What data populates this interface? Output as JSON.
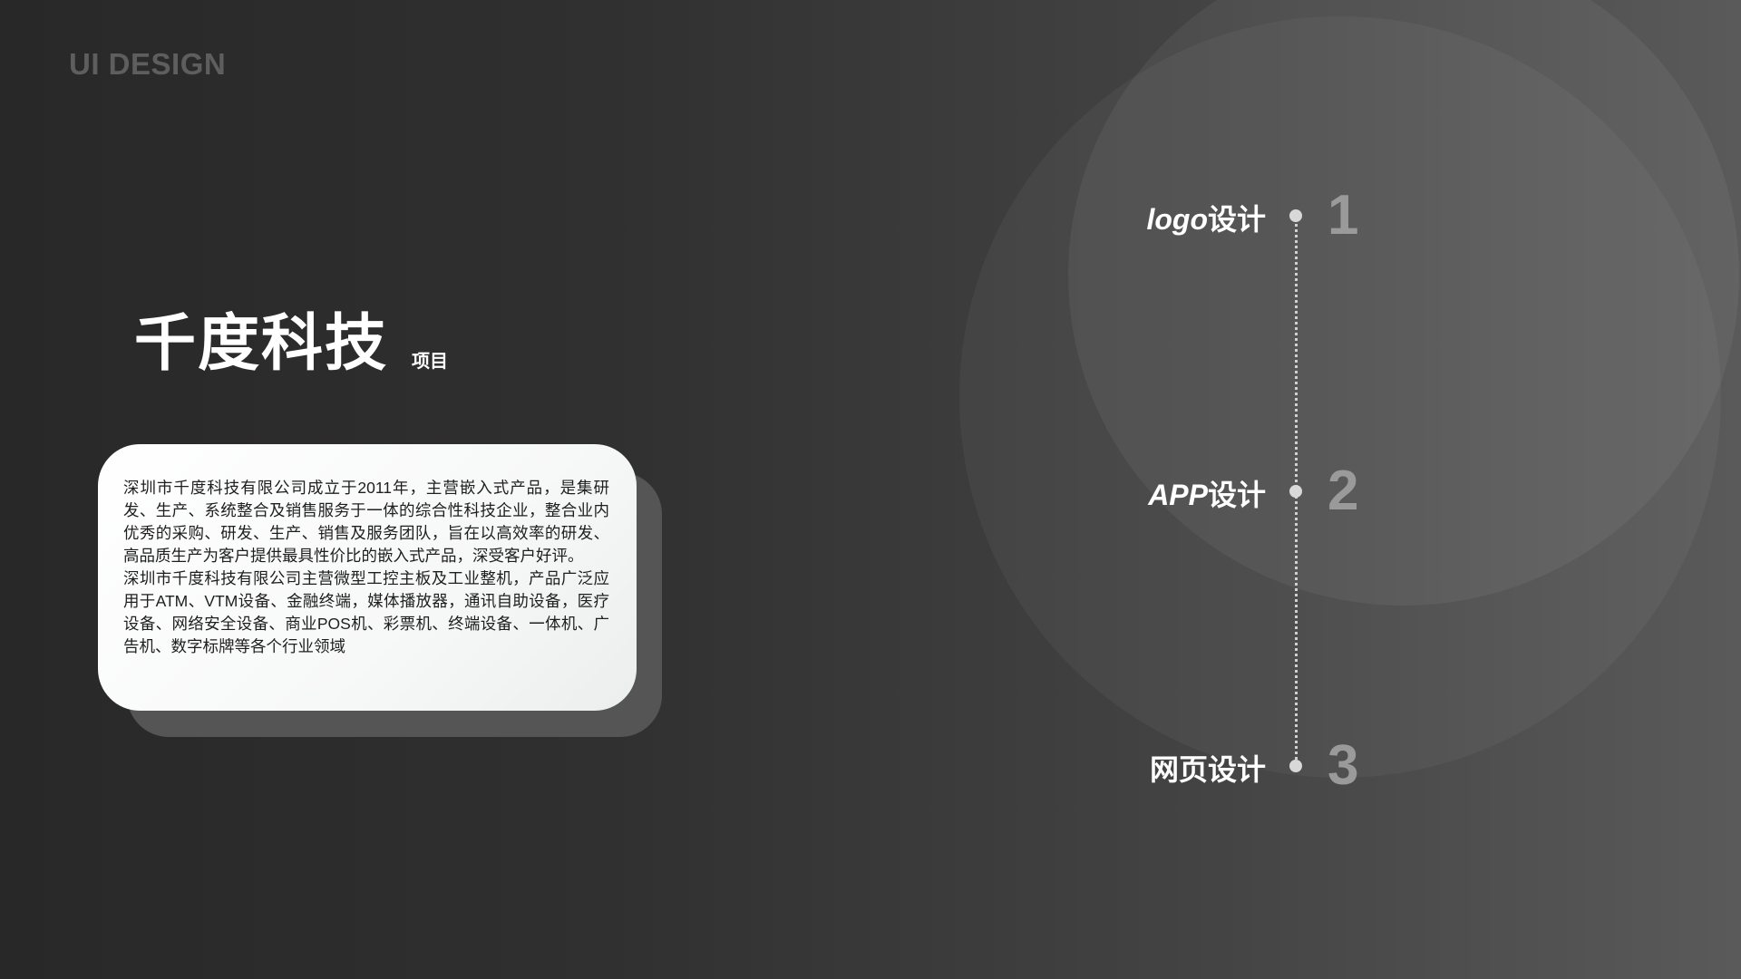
{
  "brand": "UI DESIGN",
  "title": {
    "main": "千度科技",
    "sub": "项目"
  },
  "card": {
    "paragraph1": "深圳市千度科技有限公司成立于2011年，主营嵌入式产品，是集研发、生产、系统整合及销售服务于一体的综合性科技企业，整合业内优秀的采购、研发、生产、销售及服务团队，旨在以高效率的研发、高品质生产为客户提供最具性价比的嵌入式产品，深受客户好评。",
    "paragraph2": "深圳市千度科技有限公司主营微型工控主板及工业整机，产品广泛应用于ATM、VTM设备、金融终端，媒体播放器，通讯自助设备，医疗设备、网络安全设备、商业POS机、彩票机、终端设备、一体机、广告机、数字标牌等各个行业领域"
  },
  "steps": [
    {
      "label_latin": "logo",
      "label_cn": "设计",
      "number": "1"
    },
    {
      "label_latin": "APP",
      "label_cn": "设计",
      "number": "2"
    },
    {
      "label_latin": "",
      "label_cn": "网页设计",
      "number": "3"
    }
  ],
  "colors": {
    "background_dark": "#282828",
    "background_light": "#5a5a5a",
    "card": "#ffffff",
    "card_shadow": "#555555",
    "number": "#9a9a9a",
    "brand": "#5e5e5e"
  }
}
